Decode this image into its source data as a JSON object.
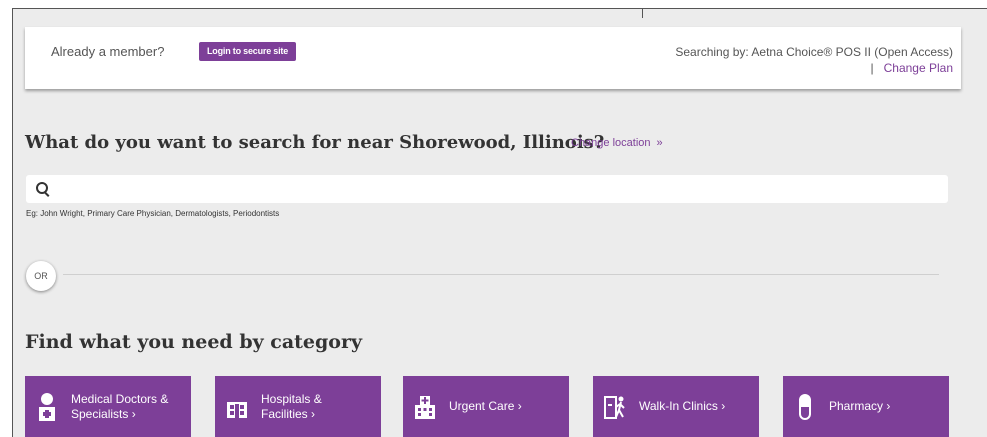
{
  "member_bar": {
    "prompt": "Already a member?",
    "login_button": "Login to secure site",
    "searching_by": "Searching by: Aetna Choice® POS II (Open Access)",
    "separator": "|",
    "change_plan": "Change Plan"
  },
  "search": {
    "heading": "What do you want to search for near Shorewood, Illinois?",
    "change_location": "Change location",
    "change_location_arrow": "»",
    "value": "",
    "hint": "Eg: John Wright, Primary Care Physician, Dermatologists, Periodontists"
  },
  "divider": {
    "or_label": "OR"
  },
  "categories": {
    "heading": "Find what you need by category",
    "items": [
      {
        "line1": "Medical Doctors &",
        "line2": "Specialists ›",
        "icon": "doctor-icon"
      },
      {
        "line1": "Hospitals &",
        "line2": "Facilities ›",
        "icon": "hospital-icon"
      },
      {
        "line1": "Urgent Care ›",
        "icon": "urgent-care-icon"
      },
      {
        "line1": "Walk-In Clinics ›",
        "icon": "walk-in-clinic-icon"
      },
      {
        "line1": "Pharmacy ›",
        "icon": "pharmacy-icon"
      }
    ]
  },
  "colors": {
    "brand_purple": "#7d3f98",
    "background": "#ececec"
  }
}
